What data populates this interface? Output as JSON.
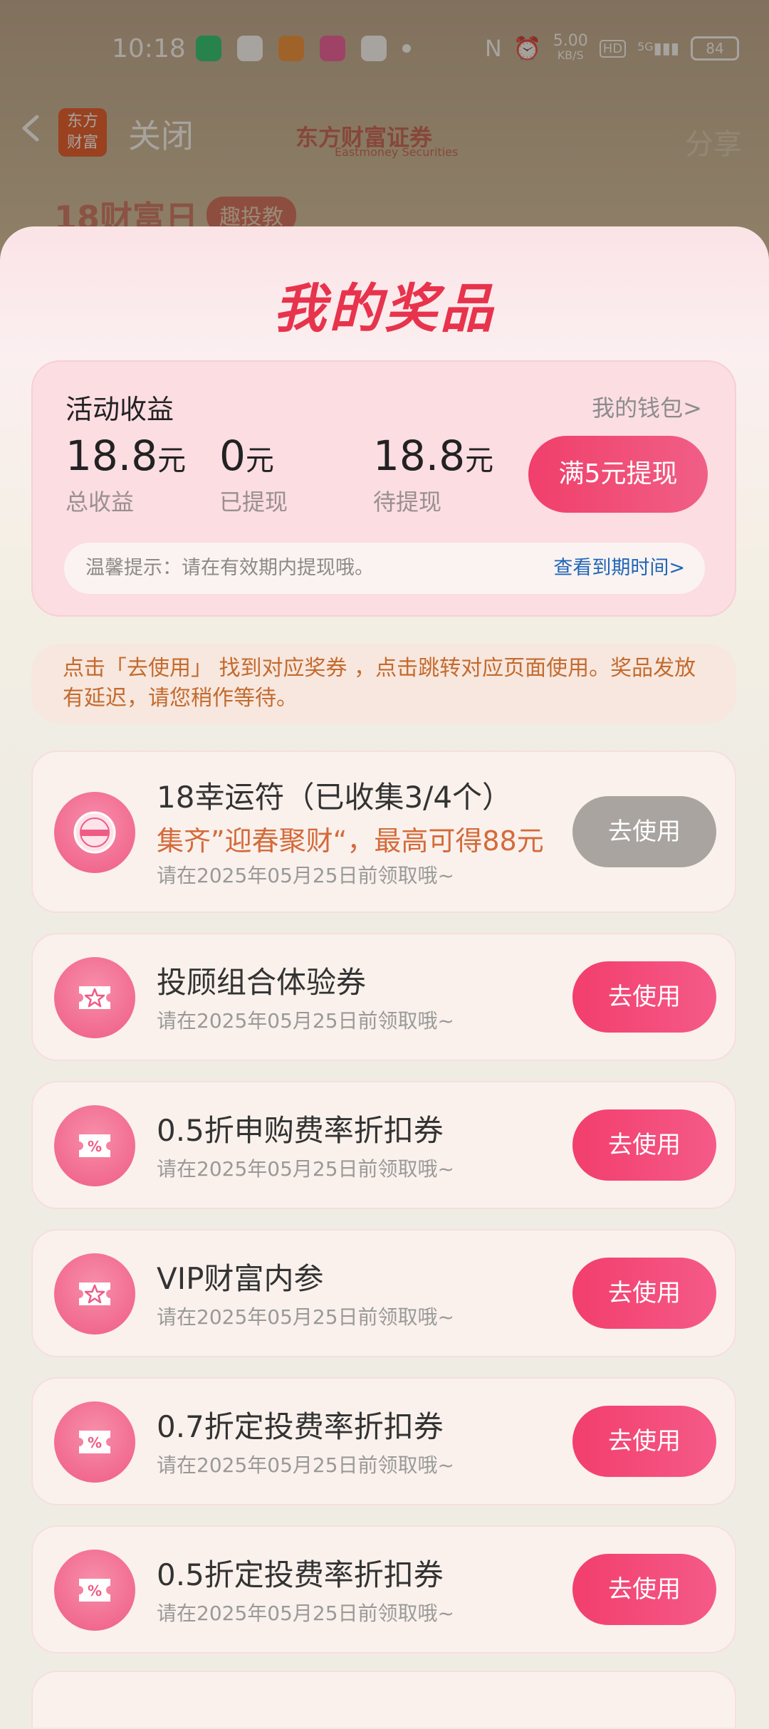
{
  "status_bar": {
    "time": "10:18",
    "network_speed": "5.00",
    "network_unit": "KB/S",
    "hd_label": "HD",
    "signal_label": "5G",
    "battery": "84"
  },
  "nav": {
    "logo_text_line1": "东方",
    "logo_text_line2": "财富",
    "close_label": "关闭",
    "brand_name": "东方财富证券",
    "brand_sub": "Eastmoney Securities",
    "share_label": "分享",
    "banner_title": "18财富日",
    "banner_tag": "趣投教"
  },
  "sheet": {
    "title": "我的奖品",
    "earnings": {
      "title": "活动收益",
      "wallet_link": "我的钱包>",
      "stats": [
        {
          "value": "18.8",
          "unit": "元",
          "label": "总收益"
        },
        {
          "value": "0",
          "unit": "元",
          "label": "已提现"
        },
        {
          "value": "18.8",
          "unit": "元",
          "label": "待提现"
        }
      ],
      "withdraw_button": "满5元提现",
      "tip_text": "温馨提示：请在有效期内提现哦。",
      "tip_link": "查看到期时间>"
    },
    "notice": "点击「去使用」 找到对应奖券 ，点击跳转对应页面使用。奖品发放有延迟，请您稍作等待。",
    "prizes": [
      {
        "name": "18幸运符（已收集3/4个）",
        "sub": "集齐”迎春聚财“，最高可得88元",
        "deadline": "请在2025年05月25日前领取哦~",
        "button": "去使用",
        "icon": "eastmoney-badge-icon"
      },
      {
        "name": "投顾组合体验券",
        "deadline": "请在2025年05月25日前领取哦~",
        "button": "去使用",
        "icon": "star-ticket-icon"
      },
      {
        "name": "0.5折申购费率折扣券",
        "deadline": "请在2025年05月25日前领取哦~",
        "button": "去使用",
        "icon": "percent-ticket-icon"
      },
      {
        "name": "VIP财富内参",
        "deadline": "请在2025年05月25日前领取哦~",
        "button": "去使用",
        "icon": "star-ticket-icon"
      },
      {
        "name": "0.7折定投费率折扣券",
        "deadline": "请在2025年05月25日前领取哦~",
        "button": "去使用",
        "icon": "percent-ticket-icon"
      },
      {
        "name": "0.5折定投费率折扣券",
        "deadline": "请在2025年05月25日前领取哦~",
        "button": "去使用",
        "icon": "percent-ticket-icon"
      }
    ]
  },
  "colors": {
    "accent": "#f03f6a",
    "title_red": "#e8334d",
    "link_blue": "#1e66b8",
    "notice_orange": "#c46a2d",
    "disabled_button": "#a9a4a0"
  }
}
